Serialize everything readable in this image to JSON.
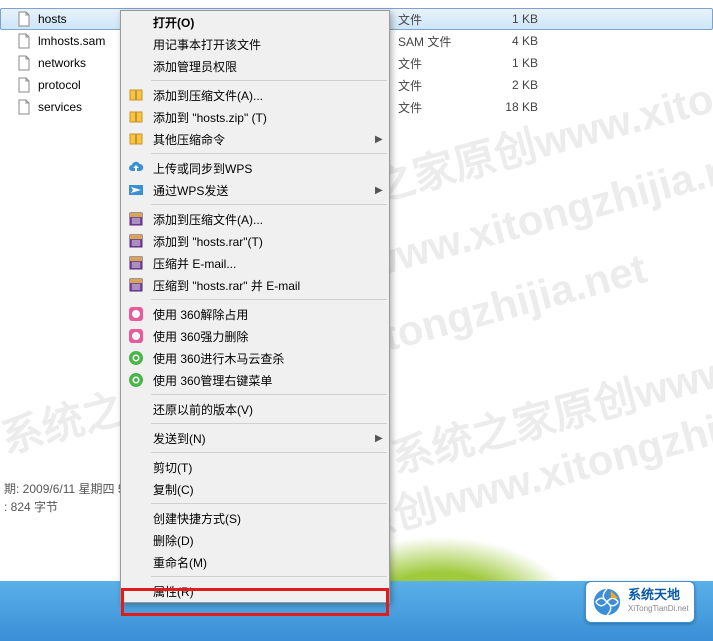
{
  "watermark_text": "系统之家原创www.xitongzhijia.net",
  "files": [
    {
      "name": "hosts",
      "date": "2009/6/11 星期...",
      "type": "文件",
      "size": "1 KB",
      "selected": true
    },
    {
      "name": "lmhosts.sam",
      "date": "",
      "type": "SAM 文件",
      "size": "4 KB",
      "selected": false
    },
    {
      "name": "networks",
      "date": "",
      "type": "文件",
      "size": "1 KB",
      "selected": false
    },
    {
      "name": "protocol",
      "date": "",
      "type": "文件",
      "size": "2 KB",
      "selected": false
    },
    {
      "name": "services",
      "date": "",
      "type": "文件",
      "size": "18 KB",
      "selected": false
    }
  ],
  "status": {
    "line1": "期: 2009/6/11 星期四 5",
    "line2": ": 824 字节"
  },
  "menu": [
    {
      "label": "打开(O)",
      "icon": "",
      "arrow": false,
      "bold": true
    },
    {
      "label": "用记事本打开该文件",
      "icon": "",
      "arrow": false
    },
    {
      "label": "添加管理员权限",
      "icon": "",
      "arrow": false
    },
    {
      "sep": true
    },
    {
      "label": "添加到压缩文件(A)...",
      "icon": "zip-yellow",
      "arrow": false
    },
    {
      "label": "添加到 \"hosts.zip\" (T)",
      "icon": "zip-yellow",
      "arrow": false
    },
    {
      "label": "其他压缩命令",
      "icon": "zip-yellow",
      "arrow": true
    },
    {
      "sep": true
    },
    {
      "label": "上传或同步到WPS",
      "icon": "cloud-up",
      "arrow": false
    },
    {
      "label": "通过WPS发送",
      "icon": "wps-send",
      "arrow": true
    },
    {
      "sep": true
    },
    {
      "label": "添加到压缩文件(A)...",
      "icon": "winrar",
      "arrow": false
    },
    {
      "label": "添加到 \"hosts.rar\"(T)",
      "icon": "winrar",
      "arrow": false
    },
    {
      "label": "压缩并 E-mail...",
      "icon": "winrar",
      "arrow": false
    },
    {
      "label": "压缩到 \"hosts.rar\" 并 E-mail",
      "icon": "winrar",
      "arrow": false
    },
    {
      "sep": true
    },
    {
      "label": "使用 360解除占用",
      "icon": "360-pink",
      "arrow": false
    },
    {
      "label": "使用 360强力删除",
      "icon": "360-pink",
      "arrow": false
    },
    {
      "label": "使用 360进行木马云查杀",
      "icon": "360-green",
      "arrow": false
    },
    {
      "label": "使用 360管理右键菜单",
      "icon": "360-green",
      "arrow": false
    },
    {
      "sep": true
    },
    {
      "label": "还原以前的版本(V)",
      "icon": "",
      "arrow": false
    },
    {
      "sep": true
    },
    {
      "label": "发送到(N)",
      "icon": "",
      "arrow": true
    },
    {
      "sep": true
    },
    {
      "label": "剪切(T)",
      "icon": "",
      "arrow": false
    },
    {
      "label": "复制(C)",
      "icon": "",
      "arrow": false
    },
    {
      "sep": true
    },
    {
      "label": "创建快捷方式(S)",
      "icon": "",
      "arrow": false
    },
    {
      "label": "删除(D)",
      "icon": "",
      "arrow": false
    },
    {
      "label": "重命名(M)",
      "icon": "",
      "arrow": false
    },
    {
      "sep": true
    },
    {
      "label": "属性(R)",
      "icon": "",
      "arrow": false
    }
  ],
  "logo": {
    "cn": "系统天地",
    "en": "XiTongTianDi.net"
  }
}
